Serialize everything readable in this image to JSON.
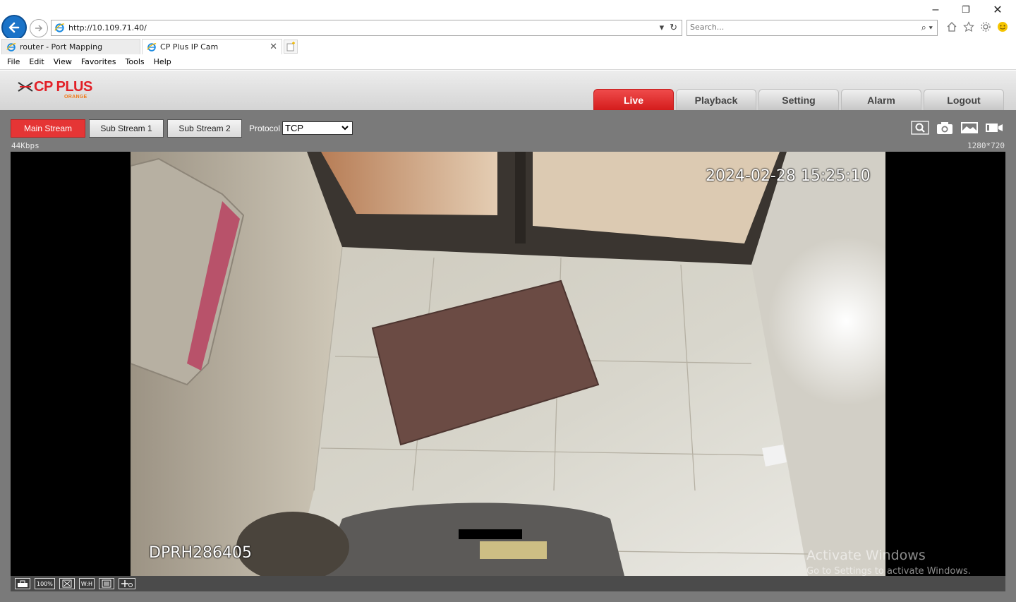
{
  "browser": {
    "url": "http://10.109.71.40/",
    "search_placeholder": "Search...",
    "tabs": [
      {
        "label": "router - Port Mapping"
      },
      {
        "label": "CP Plus IP Cam"
      }
    ],
    "menu": [
      "File",
      "Edit",
      "View",
      "Favorites",
      "Tools",
      "Help"
    ]
  },
  "app": {
    "logo_text": "CP PLUS",
    "logo_sub": "ORANGE",
    "nav": [
      "Live",
      "Playback",
      "Setting",
      "Alarm",
      "Logout"
    ],
    "active_nav": "Live"
  },
  "toolbar": {
    "streams": [
      "Main Stream",
      "Sub Stream 1",
      "Sub Stream 2"
    ],
    "active_stream": "Main Stream",
    "protocol_label": "Protocol",
    "protocol_value": "TCP"
  },
  "video": {
    "bitrate": "44Kbps",
    "resolution": "1280*720",
    "osd_time": "2024-02-28 15:25:10",
    "osd_name": "DPRH286405",
    "watermark_title": "Activate Windows",
    "watermark_sub": "Go to Settings to activate Windows."
  },
  "bottom_bar": {
    "zoom_label": "100%",
    "wh_label": "W:H"
  },
  "colors": {
    "accent_red": "#e53535",
    "toolbar_gray": "#7a7a7a"
  }
}
